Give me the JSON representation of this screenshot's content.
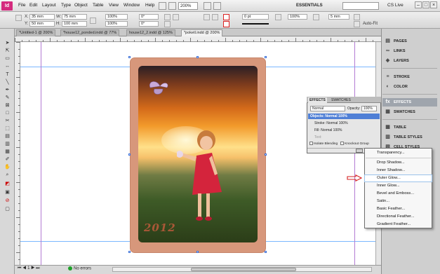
{
  "app": {
    "logo_text": "Id",
    "menu": [
      "File",
      "Edit",
      "Layout",
      "Type",
      "Object",
      "Table",
      "View",
      "Window",
      "Help"
    ],
    "zoom": "200%",
    "workspace": "ESSENTIALS",
    "cs_live": "CS Live"
  },
  "control_panel": {
    "x_label": "X:",
    "x_value": "35 mm",
    "y_label": "Y:",
    "y_value": "50 mm",
    "w_label": "W:",
    "w_value": "75 mm",
    "h_label": "H:",
    "h_value": "100 mm",
    "scale_x": "100%",
    "scale_y": "100%",
    "rotate": "0°",
    "shear": "0°",
    "stroke_weight": "0 pt",
    "opacity": "100%",
    "size_field": "5 mm",
    "autofit_label": "Auto-Fit"
  },
  "doc_tabs": [
    "*Untitled-1 @ 200%",
    "*house12_ponded.indd @ 77%",
    "house12_2.indd @ 125%",
    "*poketl.indd @ 200%"
  ],
  "artwork": {
    "watermark_year": "2012"
  },
  "status": {
    "page": "1",
    "preflight": "No errors"
  },
  "dock": {
    "items": [
      "PAGES",
      "LINKS",
      "LAYERS",
      "STROKE",
      "COLOR",
      "EFFECTS",
      "SWATCHES",
      "TABLE",
      "TABLE STYLES",
      "CELL STYLES"
    ]
  },
  "effects_panel": {
    "tabs": [
      "EFFECTS",
      "SWATCHES"
    ],
    "blend_mode": "Normal",
    "opacity_label": "Opacity:",
    "opacity_value": "100%",
    "selected_row": "Objects: Normal 100%",
    "stroke_row_label": "Stroke:",
    "stroke_row_value": "Normal 100%",
    "fill_row_label": "Fill:",
    "fill_row_value": "Normal 100%",
    "text_row_label": "Text:",
    "isolate_label": "Isolate Blending",
    "knockout_label": "Knockout Group"
  },
  "fx_menu": {
    "items": [
      "Transparency...",
      "Drop Shadow...",
      "Inner Shadow...",
      "Outer Glow...",
      "Inner Glow...",
      "Bevel and Emboss...",
      "Satin...",
      "Basic Feather...",
      "Directional Feather...",
      "Gradient Feather..."
    ],
    "highlighted": "Outer Glow..."
  },
  "colors": {
    "frame_fill": "#d7977b",
    "selection_blue": "#4f7fd6",
    "annotation_arrow": "#d62020"
  }
}
